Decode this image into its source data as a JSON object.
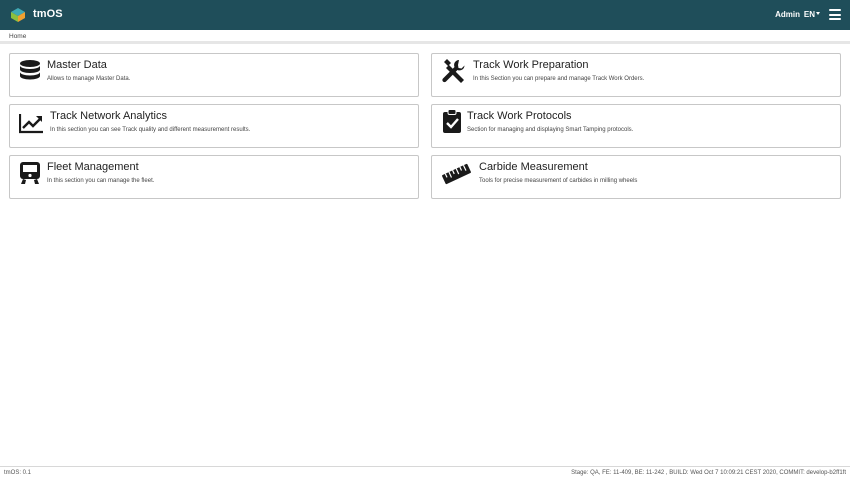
{
  "header": {
    "app_name": "tmOS",
    "user": "Admin",
    "language": "EN"
  },
  "breadcrumb": {
    "home": "Home"
  },
  "cards": [
    {
      "title": "Master Data",
      "description": "Allows to manage Master Data.",
      "icon": "database-icon"
    },
    {
      "title": "Track Work Preparation",
      "description": "In this Section you can prepare and manage Track Work Orders.",
      "icon": "tools-icon"
    },
    {
      "title": "Track Network Analytics",
      "description": "In this section you can see Track quality and different measurement results.",
      "icon": "chart-line-icon"
    },
    {
      "title": "Track Work Protocols",
      "description": "Section for managing and displaying Smart Tamping protocols.",
      "icon": "clipboard-check-icon"
    },
    {
      "title": "Fleet Management",
      "description": "In this section you can manage the fleet.",
      "icon": "train-icon"
    },
    {
      "title": "Carbide Measurement",
      "description": "Tools for precise measurement of carbides in milling wheels",
      "icon": "ruler-icon"
    }
  ],
  "footer": {
    "version": "tmOS: 0.1",
    "build_info": "Stage: QA, FE: 11-409, BE: 11-242 , BUILD: Wed Oct 7 10:09:21 CEST 2020, COMMIT: develop-b2ff1ft"
  },
  "colors": {
    "topbar": "#1f4e5a",
    "card_border": "#c7c7c7",
    "icon": "#1a1a1a"
  }
}
